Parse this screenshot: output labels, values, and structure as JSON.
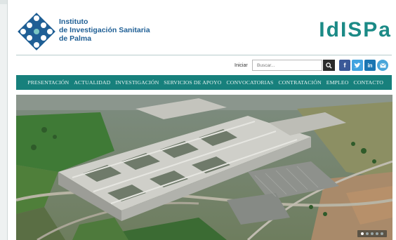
{
  "logo": {
    "line1": "Instituto",
    "line2": "de Investigación Sanitaria",
    "line3": "de Palma",
    "brand": "IdISPa"
  },
  "search": {
    "login_label": "Iniciar",
    "placeholder": "Buscar..."
  },
  "social": [
    {
      "icon": "facebook-icon",
      "glyph": "f",
      "color": "#3b5998"
    },
    {
      "icon": "twitter-icon",
      "glyph": "t",
      "color": "#42a3e0"
    },
    {
      "icon": "linkedin-icon",
      "glyph": "in",
      "color": "#1a75b2"
    },
    {
      "icon": "email-icon",
      "glyph": "@",
      "color": "#4aa6da"
    }
  ],
  "nav": {
    "items": [
      "PRESENTACIÓN",
      "ACTUALIDAD",
      "INVESTIGACIÓN",
      "SERVICIOS DE APOYO",
      "CONVOCATORIAS",
      "CONTRATACIÓN",
      "EMPLEO",
      "CONTACTO"
    ]
  },
  "hero": {
    "slides": 5,
    "active_slide": 1
  },
  "colors": {
    "accent": "#17807c",
    "brand": "#1b8a86",
    "logo_blue": "#1f5f95"
  }
}
